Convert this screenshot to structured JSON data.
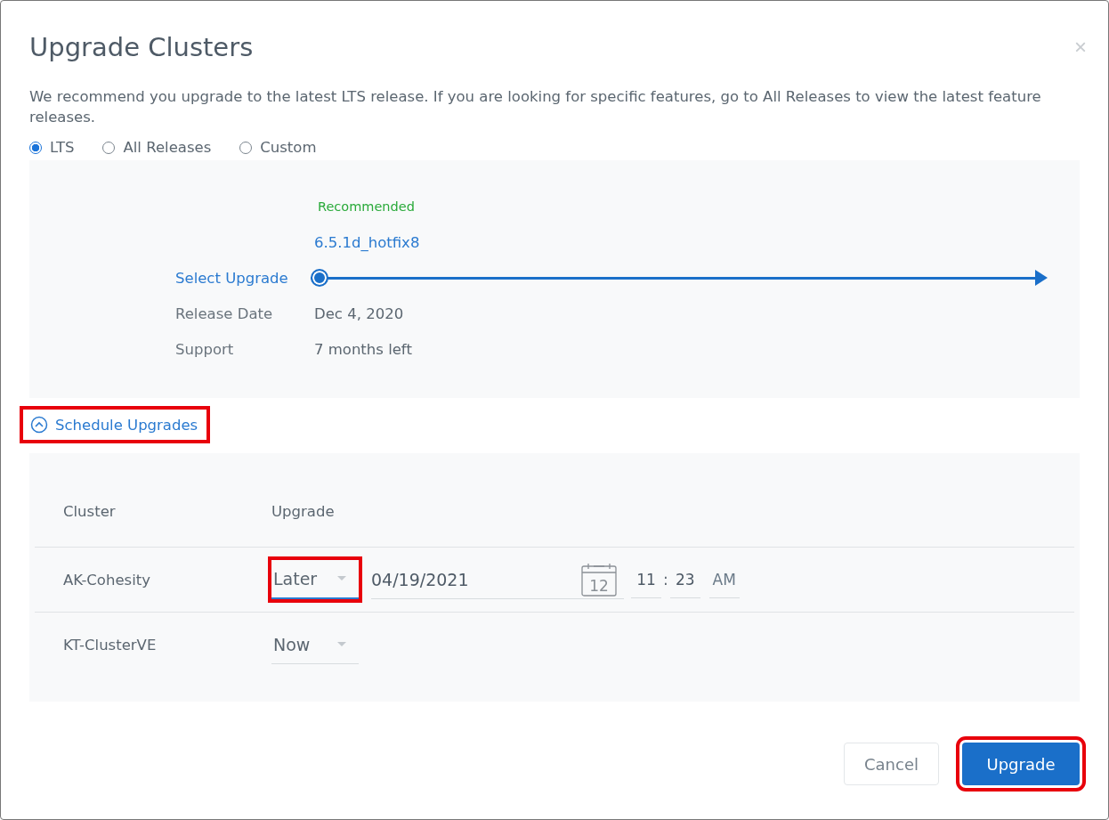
{
  "dialog": {
    "title": "Upgrade Clusters",
    "close": "×",
    "description": "We recommend you upgrade to the latest LTS release. If you are looking for specific features, go to All Releases to view the latest feature releases."
  },
  "release_types": [
    {
      "label": "LTS",
      "selected": true
    },
    {
      "label": "All Releases",
      "selected": false
    },
    {
      "label": "Custom",
      "selected": false
    }
  ],
  "release": {
    "badge": "Recommended",
    "version": "6.5.1d_hotfix8",
    "select_label": "Select Upgrade",
    "level": 0,
    "details": [
      {
        "label": "Release Date",
        "value": "Dec 4, 2020"
      },
      {
        "label": "Support",
        "value": "7 months left"
      }
    ]
  },
  "schedule": {
    "label": "Schedule Upgrades",
    "expanded": true,
    "highlighted": true,
    "columns": [
      "Cluster",
      "Upgrade"
    ],
    "rows": [
      {
        "cluster": "AK-Cohesity",
        "upgrade": "Later",
        "highlighted": true,
        "date": "04/19/2021",
        "calendar_day": "12",
        "hour": "11",
        "separator": ":",
        "minute": "23",
        "period": "AM"
      },
      {
        "cluster": "KT-ClusterVE",
        "upgrade": "Now",
        "highlighted": false
      }
    ]
  },
  "buttons": [
    {
      "label": "Cancel",
      "kind": "secondary",
      "highlighted": false
    },
    {
      "label": "Upgrade",
      "kind": "primary",
      "highlighted": true
    }
  ]
}
